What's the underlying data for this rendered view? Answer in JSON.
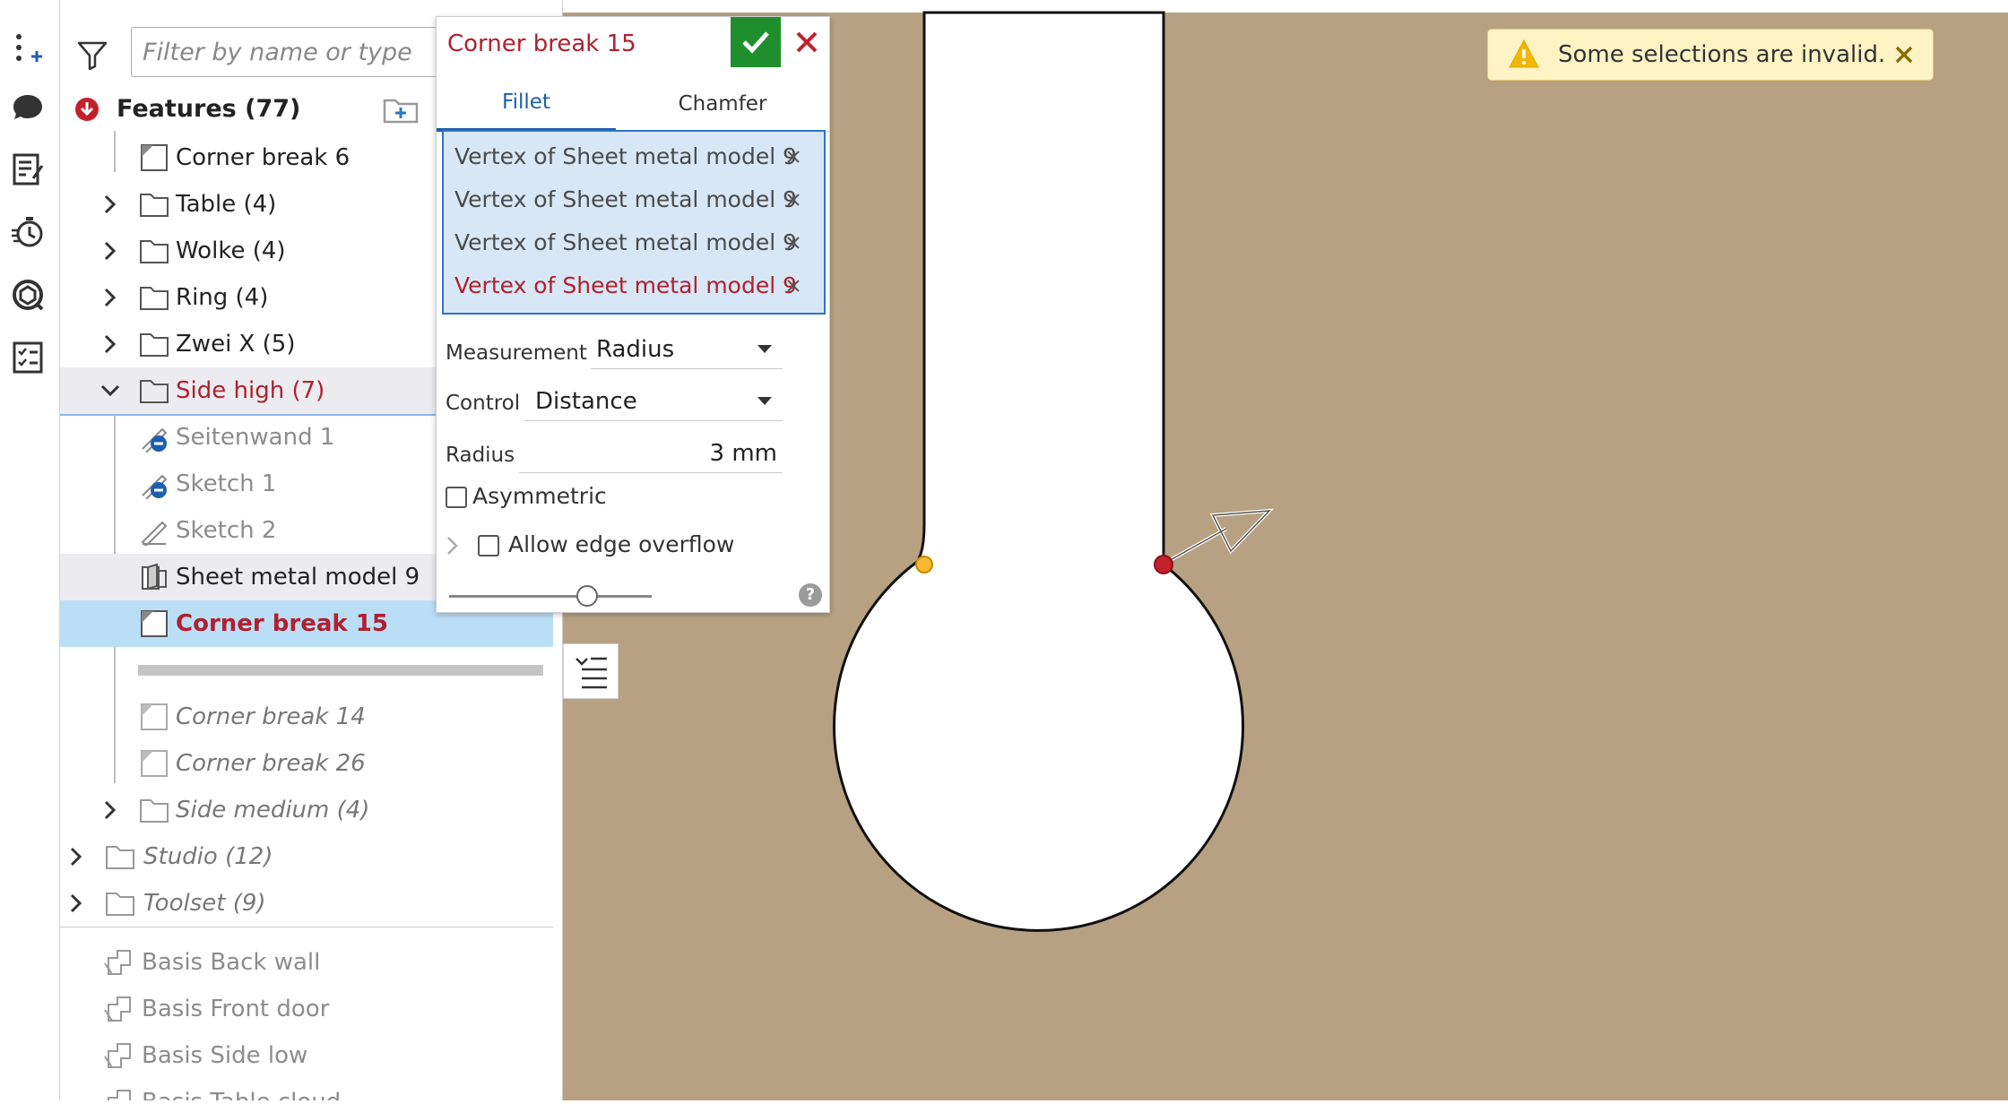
{
  "filter": {
    "placeholder": "Filter by name or type"
  },
  "features_header": "Features (77)",
  "tree": [
    {
      "label": "Corner break 6",
      "icon": "corner-break-icon"
    },
    {
      "label": "Table (4)",
      "icon": "folder-icon"
    },
    {
      "label": "Wolke (4)",
      "icon": "folder-icon"
    },
    {
      "label": "Ring (4)",
      "icon": "folder-icon"
    },
    {
      "label": "Zwei X (5)",
      "icon": "folder-icon"
    },
    {
      "label": "Side high (7)",
      "icon": "folder-icon",
      "expanded": true
    },
    {
      "label": "Seitenwand 1",
      "icon": "sketch-icon",
      "status": "suppressed"
    },
    {
      "label": "Sketch 1",
      "icon": "sketch-icon",
      "status": "suppressed"
    },
    {
      "label": "Sketch 2",
      "icon": "sketch-icon"
    },
    {
      "label": "Sheet metal model 9",
      "icon": "sheet-metal-icon"
    },
    {
      "label": "Corner break 15",
      "icon": "corner-break-icon",
      "selected": true
    },
    {
      "label": "Corner break 14",
      "icon": "corner-break-icon",
      "rolled_back": true
    },
    {
      "label": "Corner break 26",
      "icon": "corner-break-icon",
      "rolled_back": true
    },
    {
      "label": "Side medium (4)",
      "icon": "folder-icon",
      "rolled_back": true
    },
    {
      "label": "Studio (12)",
      "icon": "folder-icon",
      "rolled_back": true
    },
    {
      "label": "Toolset (9)",
      "icon": "folder-icon",
      "rolled_back": true
    },
    {
      "label": "Basis Back wall",
      "icon": "part-studio-icon"
    },
    {
      "label": "Basis Front door",
      "icon": "part-studio-icon"
    },
    {
      "label": "Basis Side low",
      "icon": "part-studio-icon"
    },
    {
      "label": "Basis Table cloud",
      "icon": "part-studio-icon"
    }
  ],
  "dialog": {
    "title": "Corner break 15",
    "tabs": [
      "Fillet",
      "Chamfer"
    ],
    "selections": [
      "Vertex of Sheet metal model 9",
      "Vertex of Sheet metal model 9",
      "Vertex of Sheet metal model 9",
      "Vertex of Sheet metal model 9"
    ],
    "measurement_label": "Measurement",
    "measurement_value": "Radius",
    "control_label": "Control",
    "control_value": "Distance",
    "radius_label": "Radius",
    "radius_value": "3 mm",
    "asymmetric_label": "Asymmetric",
    "overflow_label": "Allow edge overflow",
    "help": "?"
  },
  "toast": {
    "message": "Some selections are invalid."
  },
  "colors": {
    "canvas": "#b7a182",
    "accent": "#1c5fb0",
    "error": "#b0202e",
    "ok": "#1e8f2c"
  }
}
